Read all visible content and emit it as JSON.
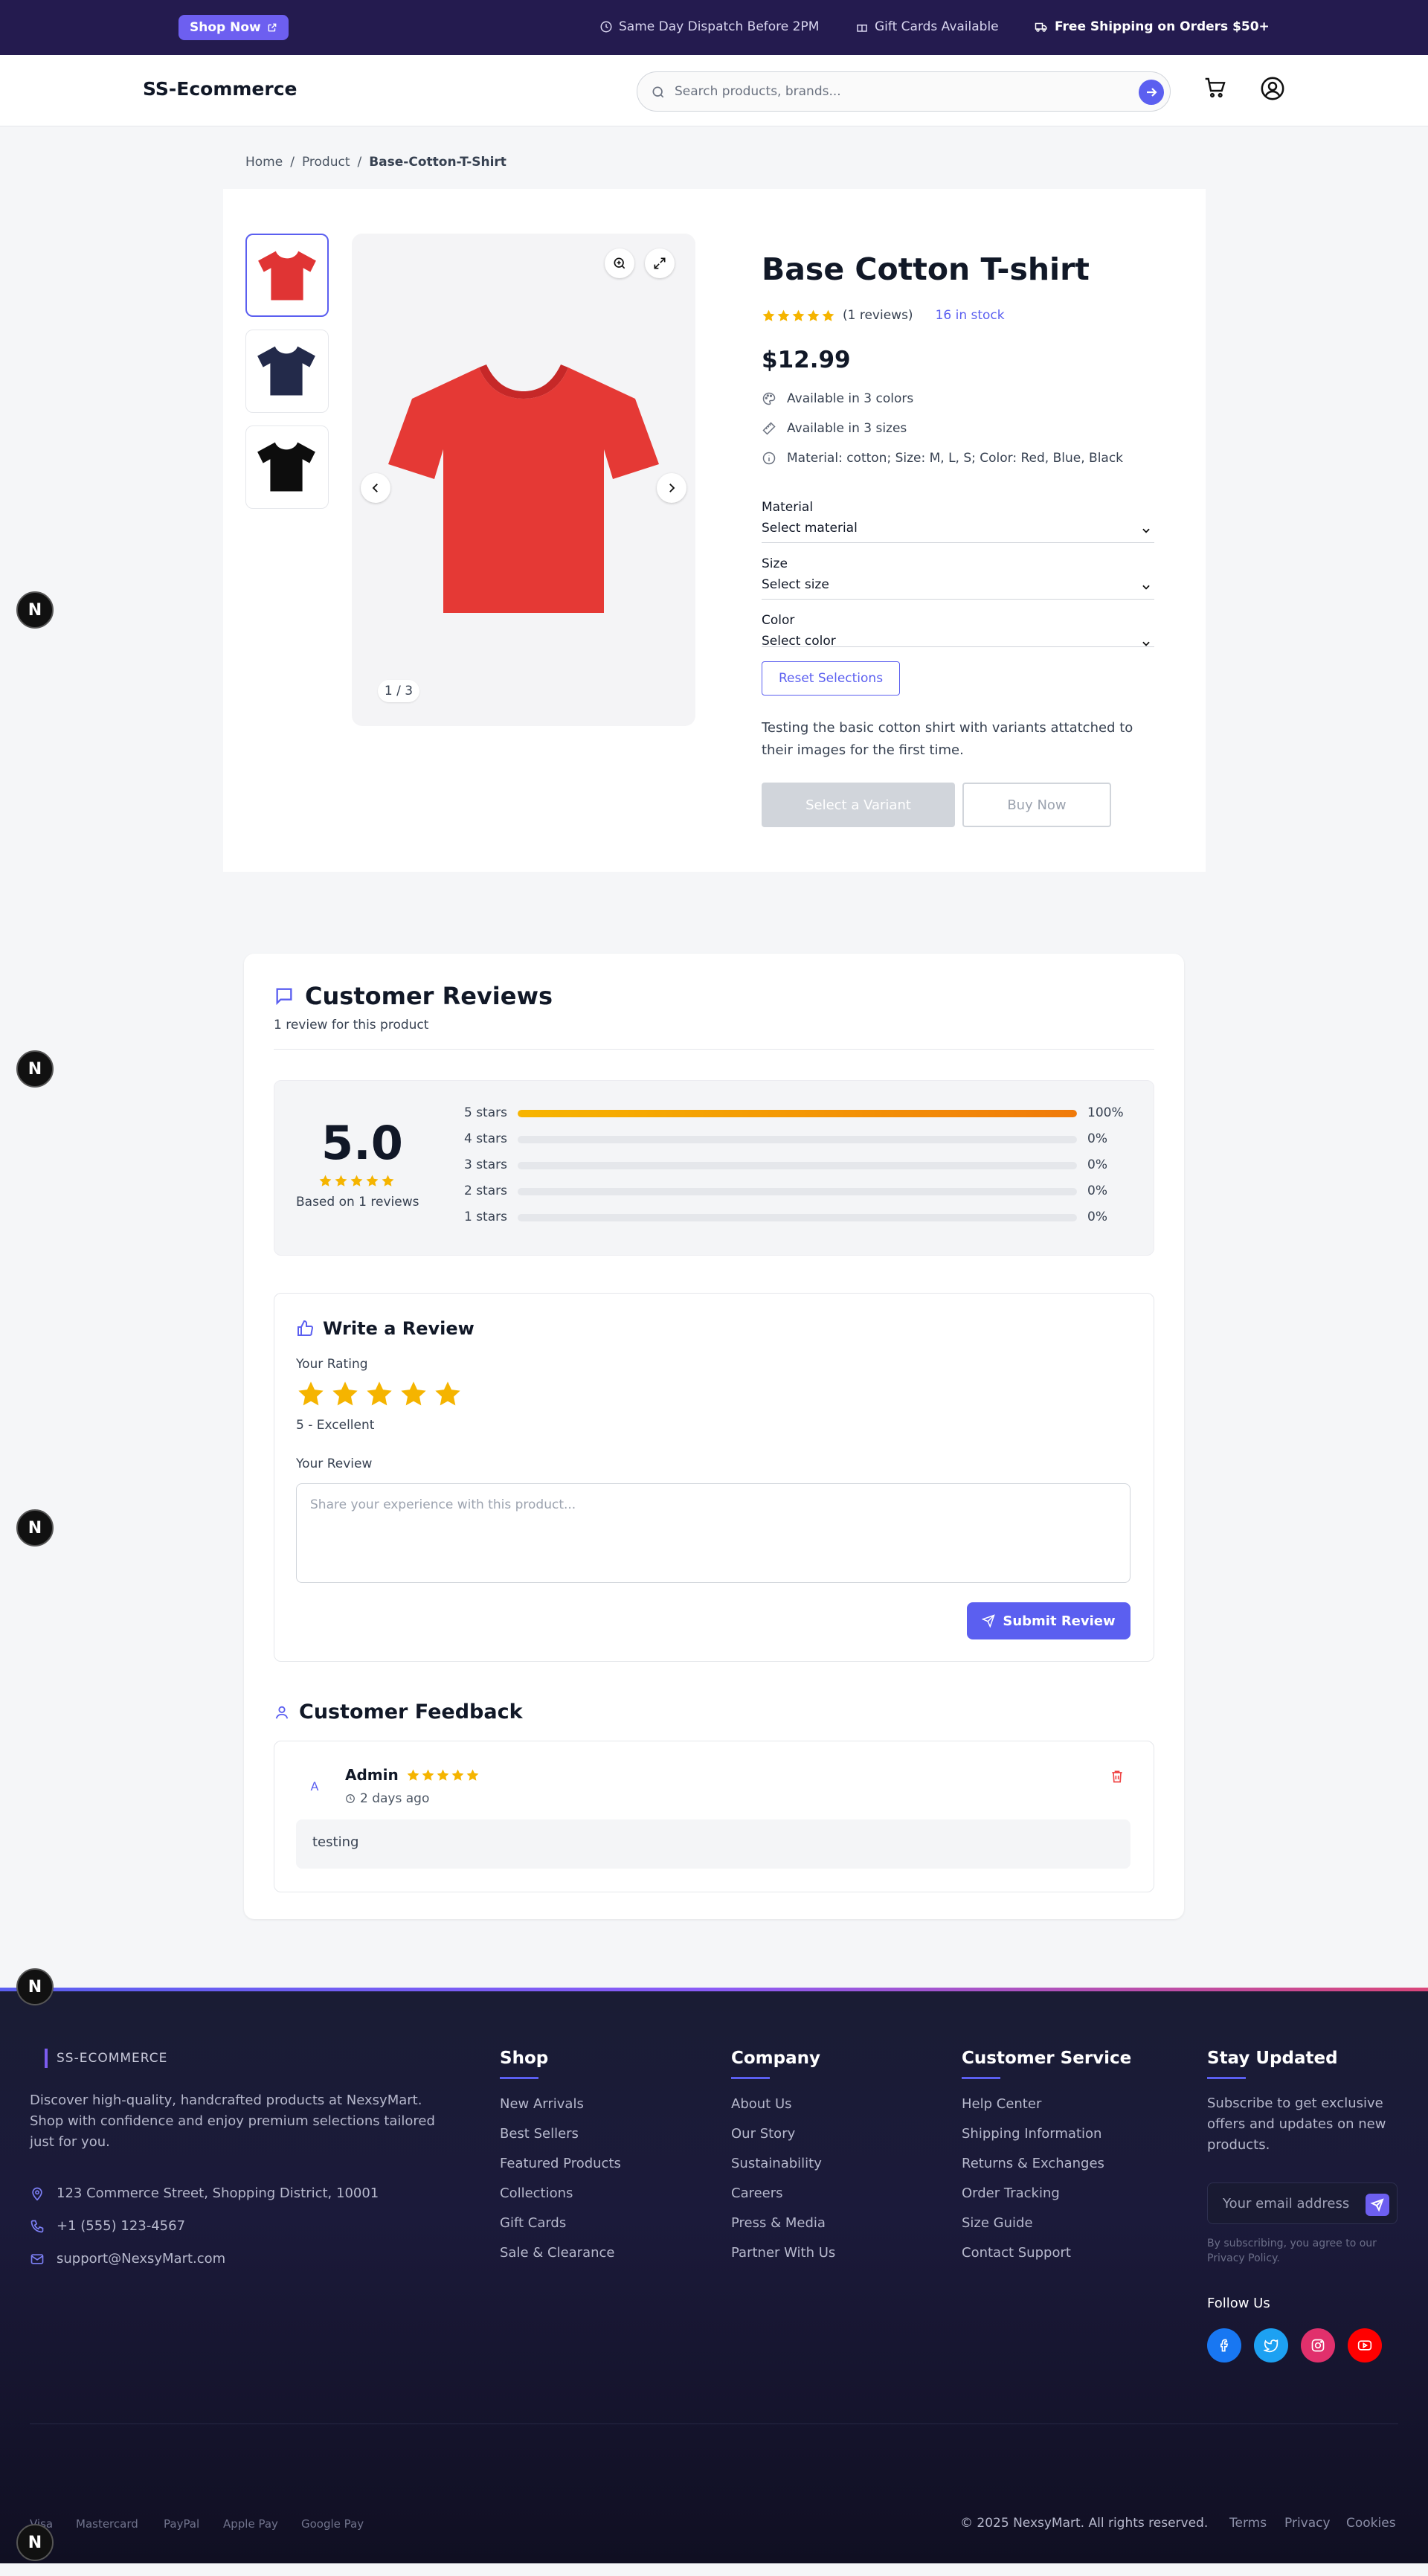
{
  "topbar": {
    "shop_now": "Shop Now",
    "promos": [
      "Same Day Dispatch Before 2PM",
      "Gift Cards Available",
      "Free Shipping on Orders $50+"
    ]
  },
  "header": {
    "logo": "SS-Ecommerce",
    "search_placeholder": "Search products, brands..."
  },
  "breadcrumb": {
    "home": "Home",
    "product": "Product",
    "current": "Base-Cotton-T-Shirt",
    "sep": "/"
  },
  "product": {
    "title": "Base Cotton T-shirt",
    "rating": 5,
    "reviews_text": "(1 reviews)",
    "stock_text": "16 in stock",
    "price": "$12.99",
    "attributes": [
      "Available in 3 colors",
      "Available in 3 sizes",
      "Material: cotton; Size: M, L, S; Color: Red, Blue, Black"
    ],
    "fields": [
      {
        "label": "Material",
        "value": "Select material"
      },
      {
        "label": "Size",
        "value": "Select size"
      },
      {
        "label": "Color",
        "value": "Select color"
      }
    ],
    "reset_label": "Reset Selections",
    "description": "Testing the basic cotton shirt with variants attatched to their images for the first time.",
    "select_variant_label": "Select a Variant",
    "buy_now_label": "Buy Now",
    "image_counter": "1 / 3",
    "thumbnail_colors": [
      "#e03434",
      "#232a4a",
      "#0d0d0d"
    ],
    "main_image_color": "#e53935"
  },
  "reviews": {
    "title": "Customer Reviews",
    "subtitle": "1 review for this product",
    "average": "5.0",
    "based_on": "Based on 1 reviews",
    "distribution": [
      {
        "label": "5 stars",
        "percent": 100,
        "text": "100%"
      },
      {
        "label": "4 stars",
        "percent": 0,
        "text": "0%"
      },
      {
        "label": "3 stars",
        "percent": 0,
        "text": "0%"
      },
      {
        "label": "2 stars",
        "percent": 0,
        "text": "0%"
      },
      {
        "label": "1 stars",
        "percent": 0,
        "text": "0%"
      }
    ],
    "write": {
      "title": "Write a Review",
      "rating_label": "Your Rating",
      "selected_rating": 5,
      "rating_text": "5 - Excellent",
      "review_label": "Your Review",
      "placeholder": "Share your experience with this product...",
      "submit_label": "Submit Review"
    },
    "feedback": {
      "title": "Customer Feedback",
      "items": [
        {
          "initial": "A",
          "name": "Admin",
          "rating": 5,
          "time": "2 days ago",
          "text": "testing"
        }
      ]
    }
  },
  "footer": {
    "brand": "SS-ECOMMERCE",
    "about": "Discover high-quality, handcrafted products at NexsyMart. Shop with confidence and enjoy premium selections tailored just for you.",
    "address": "123 Commerce Street, Shopping District, 10001",
    "phone": "+1 (555) 123-4567",
    "email": "support@NexsyMart.com",
    "columns": [
      {
        "title": "Shop",
        "links": [
          "New Arrivals",
          "Best Sellers",
          "Featured Products",
          "Collections",
          "Gift Cards",
          "Sale & Clearance"
        ]
      },
      {
        "title": "Company",
        "links": [
          "About Us",
          "Our Story",
          "Sustainability",
          "Careers",
          "Press & Media",
          "Partner With Us"
        ]
      },
      {
        "title": "Customer Service",
        "links": [
          "Help Center",
          "Shipping Information",
          "Returns & Exchanges",
          "Order Tracking",
          "Size Guide",
          "Contact Support"
        ]
      }
    ],
    "stay_title": "Stay Updated",
    "stay_text": "Subscribe to get exclusive offers and updates on new products.",
    "email_placeholder": "Your email address",
    "privacy_text": "By subscribing, you agree to our Privacy Policy.",
    "follow_title": "Follow Us",
    "social_colors": {
      "facebook": "#1877f2",
      "twitter": "#1da1f2",
      "instagram": "#e1306c",
      "youtube": "#ff0000"
    },
    "payments": [
      "Visa",
      "Mastercard",
      "PayPal",
      "Apple Pay",
      "Google Pay"
    ],
    "copyright": "© 2025 NexsyMart. All rights reserved.",
    "legal": [
      "Terms",
      "Privacy",
      "Cookies"
    ]
  },
  "dev_badge": "N",
  "colors": {
    "accent": "#5b5ff0",
    "star": "#f5b400",
    "topbar": "#241b4f"
  }
}
